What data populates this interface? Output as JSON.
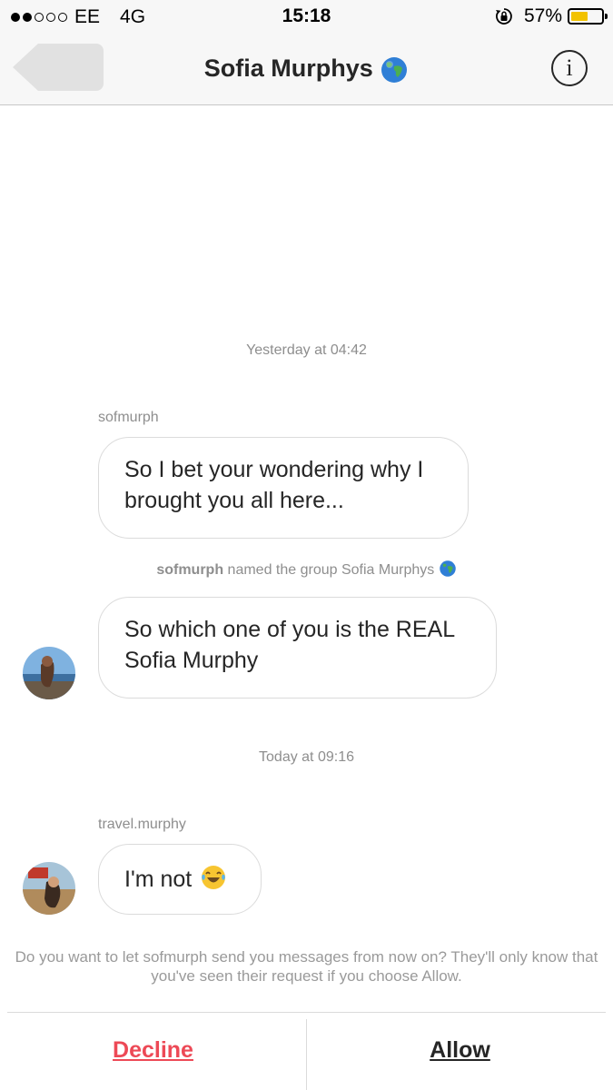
{
  "status_bar": {
    "carrier": "EE",
    "network": "4G",
    "time": "15:18",
    "battery": "57%",
    "battery_level": 0.57,
    "signal_bars_filled": 2,
    "signal_bars_total": 5
  },
  "header": {
    "title": "Sofia Murphys",
    "title_icon": "globe-icon",
    "info_icon": "info-icon",
    "info_glyph": "i"
  },
  "messages": {
    "timestamp_1": "Yesterday at 04:42",
    "sender_1": "sofmurph",
    "message_1": "So I bet your wondering why I brought you all here...",
    "system_user": "sofmurph",
    "system_text": "named the group Sofia Murphys",
    "message_2": "So which one of you is the REAL Sofia Murphy",
    "timestamp_2": "Today at 09:16",
    "sender_2": "travel.murphy",
    "message_3": "I'm not"
  },
  "request": {
    "prompt": "Do you want to let sofmurph send you messages from now on? They'll only know that you've seen their request if you choose Allow.",
    "decline_label": "Decline",
    "allow_label": "Allow"
  },
  "colors": {
    "decline": "#ed4956",
    "battery": "#f2c200",
    "muted_text": "#8e8e8e"
  }
}
